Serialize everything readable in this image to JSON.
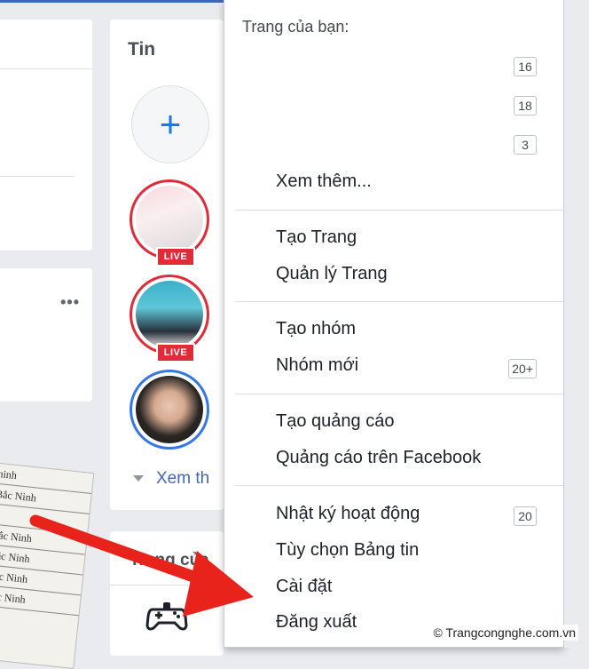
{
  "stories": {
    "title": "Tin",
    "add_label": "+",
    "live_badge": "LIVE",
    "see_more": "Xem th"
  },
  "pages_card": {
    "title": "Trang của"
  },
  "left_paper": {
    "rows": [
      "ninh",
      "Bắc Ninh",
      "",
      "Bắc Ninh",
      "Bắc Ninh",
      "Bắc Ninh",
      "Bắc Ninh"
    ]
  },
  "menu": {
    "header": "Trang của bạn:",
    "page_badges": [
      "16",
      "18",
      "3"
    ],
    "see_more": "Xem thêm...",
    "section_pages": [
      "Tạo Trang",
      "Quản lý Trang"
    ],
    "section_groups": [
      "Tạo nhóm",
      "Nhóm mới"
    ],
    "new_groups_badge": "20+",
    "section_ads": [
      "Tạo quảng cáo",
      "Quảng cáo trên Facebook"
    ],
    "section_account": [
      "Nhật ký hoạt động",
      "Tùy chọn Bảng tin",
      "Cài đặt",
      "Đăng xuất"
    ],
    "activity_badge": "20"
  },
  "watermark": "© Trangcongnghe.com.vn",
  "colors": {
    "accent": "#4267b2",
    "live": "#e02b38",
    "arrow": "#e8231c"
  }
}
